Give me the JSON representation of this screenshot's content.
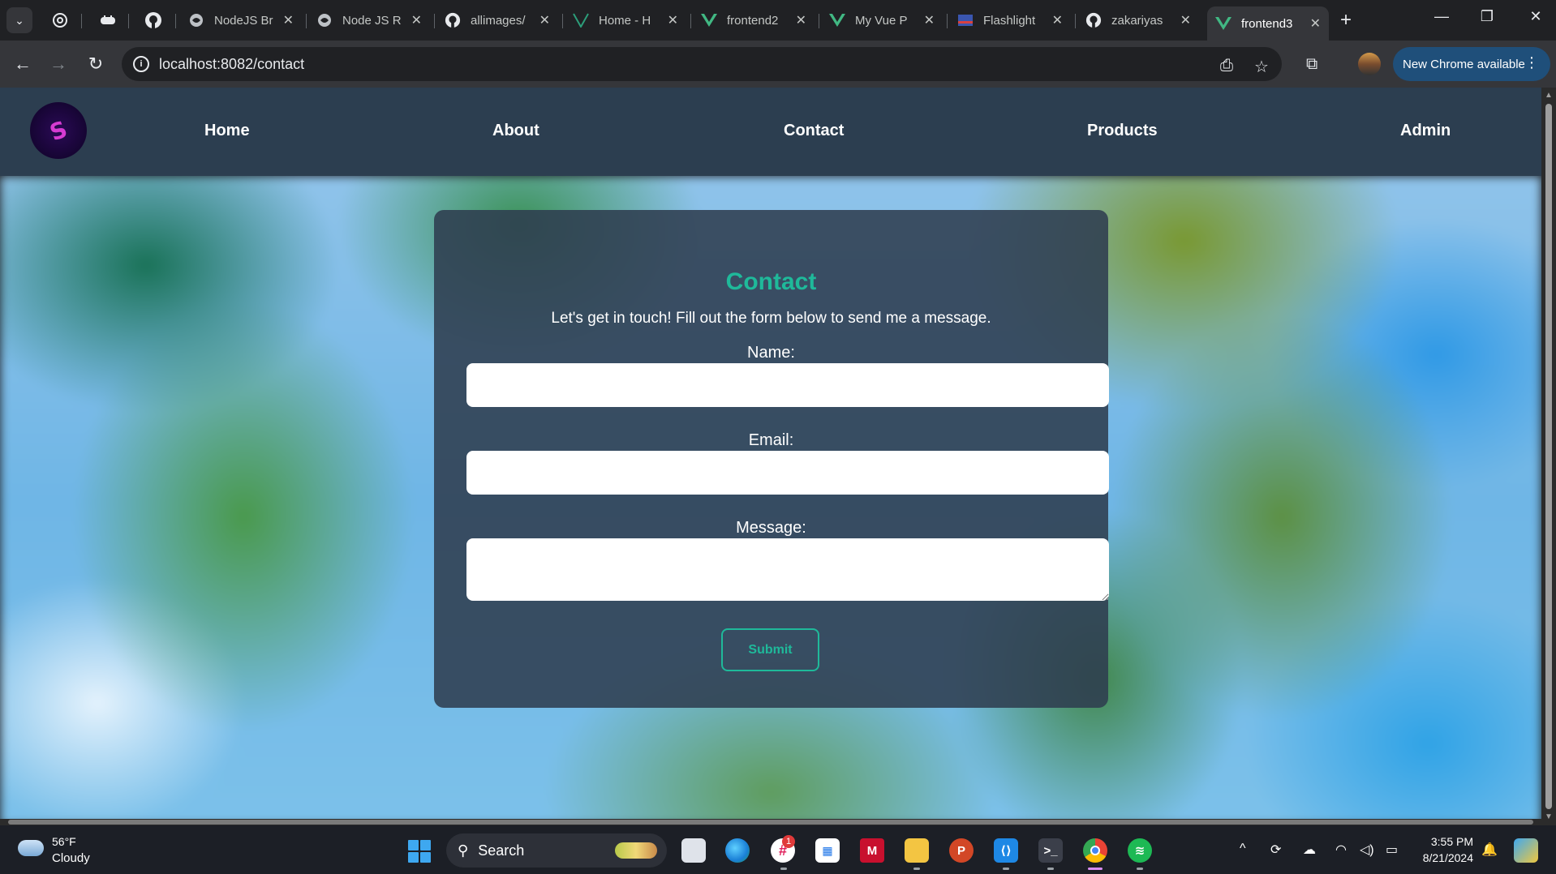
{
  "browser": {
    "tabs": [
      {
        "title": "NodeJS Br",
        "icon": "globe-icon"
      },
      {
        "title": "Node JS R",
        "icon": "globe-icon"
      },
      {
        "title": "allimages/",
        "icon": "github-icon"
      },
      {
        "title": "Home - H",
        "icon": "vite-icon"
      },
      {
        "title": "frontend2",
        "icon": "vue-icon"
      },
      {
        "title": "My Vue P",
        "icon": "vue-icon"
      },
      {
        "title": "Flashlight",
        "icon": "flag-icon"
      },
      {
        "title": "zakariyas",
        "icon": "github-icon"
      },
      {
        "title": "frontend3",
        "icon": "vue-icon",
        "active": true
      }
    ],
    "url": "localhost:8082/contact",
    "update_label": "New Chrome available"
  },
  "site": {
    "nav": {
      "home": "Home",
      "about": "About",
      "contact": "Contact",
      "products": "Products",
      "admin": "Admin"
    },
    "logo_text": "S"
  },
  "contact": {
    "title": "Contact",
    "intro": "Let's get in touch! Fill out the form below to send me a message.",
    "name_label": "Name:",
    "email_label": "Email:",
    "message_label": "Message:",
    "name_value": "",
    "email_value": "",
    "message_value": "",
    "submit_label": "Submit"
  },
  "taskbar": {
    "weather_temp": "56°F",
    "weather_condition": "Cloudy",
    "search_label": "Search",
    "notification_count": "1",
    "time": "3:55 PM",
    "date": "8/21/2024"
  },
  "colors": {
    "accent": "#1fb99a",
    "nav_bg": "#2c3e50",
    "chrome_update": "#1f4f7a"
  }
}
